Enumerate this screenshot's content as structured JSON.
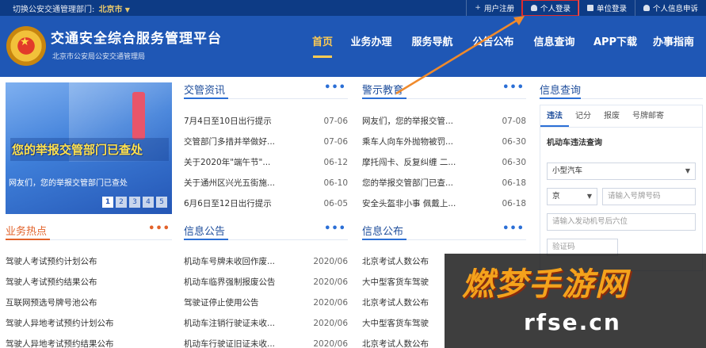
{
  "topbar": {
    "dept_prefix": "切换公安交通管理部门:",
    "dept_city": "北京市",
    "links": [
      "用户注册",
      "个人登录",
      "单位登录",
      "个人信息申诉"
    ]
  },
  "header": {
    "title": "交通安全综合服务管理平台",
    "subtitle": "北京市公安局公安交通管理局",
    "nav": [
      "首页",
      "业务办理",
      "服务导航",
      "公告公布",
      "信息查询",
      "APP下载",
      "办事指南"
    ]
  },
  "banner": {
    "headline": "您的举报交管部门已查处",
    "caption": "网友们，您的举报交管部门已查处",
    "pages": [
      "1",
      "2",
      "3",
      "4",
      "5"
    ]
  },
  "sections": {
    "traffic_news": {
      "title": "交管资讯",
      "items": [
        {
          "text": "7月4日至10日出行提示",
          "date": "07-06"
        },
        {
          "text": "交管部门多措并举做好...",
          "date": "07-06"
        },
        {
          "text": "关于2020年\"端午节\"...",
          "date": "06-12"
        },
        {
          "text": "关于通州区兴光五街施...",
          "date": "06-10"
        },
        {
          "text": "6月6日至12日出行提示",
          "date": "06-05"
        }
      ]
    },
    "warning_edu": {
      "title": "警示教育",
      "items": [
        {
          "text": "网友们，您的举报交管...",
          "date": "07-08"
        },
        {
          "text": "乘车人向车外抛物被罚...",
          "date": "06-30"
        },
        {
          "text": "摩托闯卡、反复纠缠 二...",
          "date": "06-30"
        },
        {
          "text": "您的举报交管部门已查...",
          "date": "06-18"
        },
        {
          "text": "安全头盔非小事 佩戴上...",
          "date": "06-18"
        }
      ]
    },
    "business_hot": {
      "title": "业务热点",
      "items": [
        {
          "text": "驾驶人考试预约计划公布"
        },
        {
          "text": "驾驶人考试预约结果公布"
        },
        {
          "text": "互联网预选号牌号池公布"
        },
        {
          "text": "驾驶人异地考试预约计划公布"
        },
        {
          "text": "驾驶人异地考试预约结果公布"
        }
      ]
    },
    "info_notice": {
      "title": "信息公告",
      "items": [
        {
          "text": "机动车号牌未收回作废...",
          "date": "2020/06"
        },
        {
          "text": "机动车临界强制报废公告",
          "date": "2020/06"
        },
        {
          "text": "驾驶证停止使用公告",
          "date": "2020/06"
        },
        {
          "text": "机动车注销行驶证未收...",
          "date": "2020/06"
        },
        {
          "text": "机动车行驶证旧证未收...",
          "date": "2020/06"
        }
      ]
    },
    "info_publish": {
      "title": "信息公布",
      "items": [
        {
          "text": "北京考试人数公布"
        },
        {
          "text": "大中型客货车驾驶"
        },
        {
          "text": "北京考试人数公布"
        },
        {
          "text": "大中型客货车驾驶"
        },
        {
          "text": "北京考试人数公布"
        }
      ]
    }
  },
  "info_query": {
    "title": "信息查询",
    "tabs": [
      "违法",
      "记分",
      "报废",
      "号牌邮寄"
    ],
    "subtitle": "机动车违法查询",
    "vehicle_type": "小型汽车",
    "plate_prefix": "京",
    "plate_placeholder": "请输入号牌号码",
    "engine_placeholder": "请输入发动机号后六位",
    "captcha_placeholder": "验证码"
  },
  "watermark": {
    "brand": "燃梦手游网",
    "url": "rfse.cn"
  }
}
